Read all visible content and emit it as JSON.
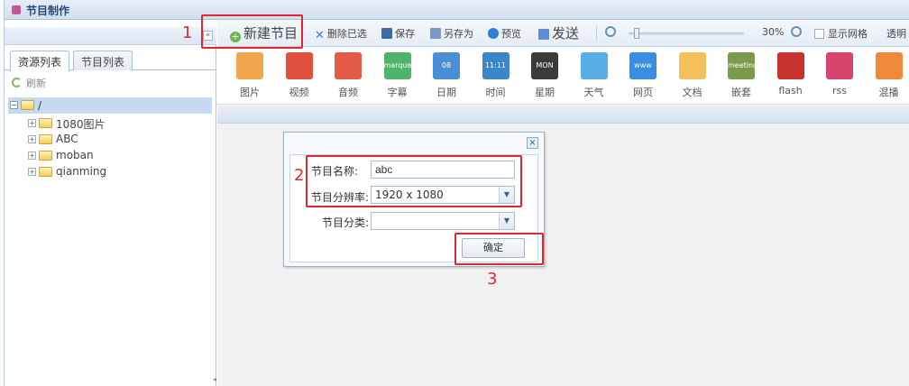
{
  "window": {
    "title": "节目制作"
  },
  "left_panel": {
    "tabs": [
      {
        "label": "资源列表",
        "active": true
      },
      {
        "label": "节目列表",
        "active": false
      }
    ],
    "refresh_label": "刷新",
    "tree_root_label": "/",
    "tree_items": [
      "1080图片",
      "ABC",
      "moban",
      "qianming"
    ]
  },
  "toolbar": {
    "new_program": "新建节目",
    "delete_selected": "删除已选",
    "save": "保存",
    "save_as": "另存为",
    "preview": "预览",
    "send": "发送",
    "zoom_value": "30%",
    "show_grid": "显示网格",
    "transparent": "透明"
  },
  "tools": [
    {
      "label": "图片",
      "icon": "image-icon",
      "color": "#f0a64a"
    },
    {
      "label": "视频",
      "icon": "video-icon",
      "color": "#e0503e"
    },
    {
      "label": "音频",
      "icon": "audio-icon",
      "color": "#e65a48"
    },
    {
      "label": "字幕",
      "icon": "marquee-icon",
      "color": "#4fb36a",
      "text": "marquee"
    },
    {
      "label": "日期",
      "icon": "calendar-icon",
      "color": "#4a8fd6",
      "text": "08"
    },
    {
      "label": "时间",
      "icon": "clock-icon",
      "color": "#3a86c8",
      "text": "11:11"
    },
    {
      "label": "星期",
      "icon": "weekday-icon",
      "color": "#3b3b3b",
      "text": "MON"
    },
    {
      "label": "天气",
      "icon": "weather-icon",
      "color": "#5aaee6"
    },
    {
      "label": "网页",
      "icon": "webpage-icon",
      "color": "#3a8de0",
      "text": "www"
    },
    {
      "label": "文档",
      "icon": "document-icon",
      "color": "#f3c05b"
    },
    {
      "label": "嵌套",
      "icon": "nested-icon",
      "color": "#7c9a4c",
      "text": "meeting"
    },
    {
      "label": "flash",
      "icon": "flash-icon",
      "color": "#c8322c"
    },
    {
      "label": "rss",
      "icon": "rss-icon",
      "color": "#d8446e"
    },
    {
      "label": "混播",
      "icon": "mixed-icon",
      "color": "#f08a3a"
    }
  ],
  "dialog": {
    "name_label": "节目名称:",
    "name_value": "abc",
    "resolution_label": "节目分辨率:",
    "resolution_value": "1920 x 1080",
    "category_label": "节目分类:",
    "category_value": "",
    "ok_button": "确定",
    "close_symbol": "×"
  },
  "annotations": {
    "step1": "1",
    "step2": "2",
    "step3": "3",
    "color": "#e0262e"
  }
}
